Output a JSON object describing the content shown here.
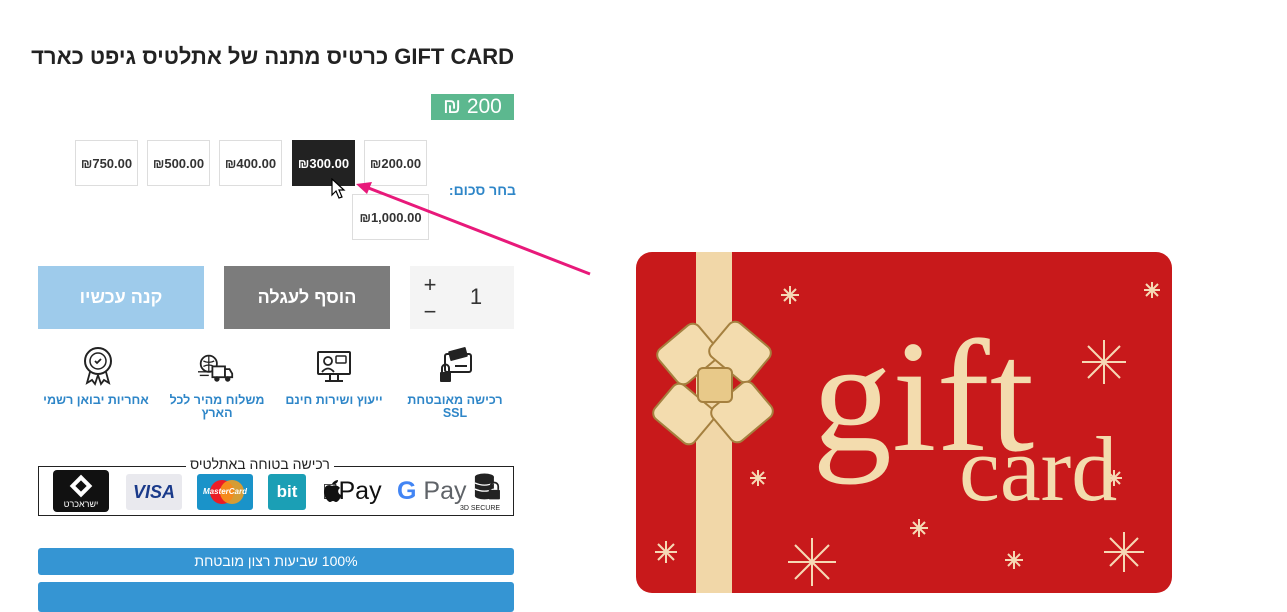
{
  "product": {
    "title": "GIFT CARD כרטיס מתנה של אתלטיס גיפט כארד",
    "price": "200 ₪"
  },
  "amount_selector": {
    "label": "בחר סכום:",
    "options": [
      "₪200.00",
      "₪300.00",
      "₪400.00",
      "₪500.00",
      "₪750.00",
      "₪1,000.00"
    ],
    "selected": "₪300.00"
  },
  "purchase": {
    "quantity": "1",
    "plus": "+",
    "minus": "−",
    "add_to_cart": "הוסף לעגלה",
    "buy_now": "קנה עכשיו"
  },
  "features": [
    {
      "label": "רכישה מאובטחת SSL",
      "icon": "secure-card-icon"
    },
    {
      "label": "ייעוץ ושירות חינם",
      "icon": "support-computer-icon"
    },
    {
      "label": "משלוח מהיר לכל הארץ",
      "icon": "fast-shipping-icon"
    },
    {
      "label": "אחריות יבואן רשמי",
      "icon": "warranty-badge-icon"
    }
  ],
  "secure_payment": {
    "title": "רכישה בטוחה באתלטיס",
    "logos": [
      "3D SECURE",
      "G Pay",
      "Pay",
      "bit",
      "MasterCard",
      "VISA",
      "ישראכרט"
    ]
  },
  "banners": {
    "satisfaction": "100% שביעות רצון מובטחת"
  },
  "gift_image": {
    "word1": "gift",
    "word2": "card"
  },
  "colors": {
    "price_bg": "#5cb88f",
    "accent_blue": "#2e86c8",
    "buy_now_bg": "#9ecbeb",
    "cart_bg": "#7c7c7c",
    "card_red": "#c8191b",
    "arrow_pink": "#e8197a"
  }
}
